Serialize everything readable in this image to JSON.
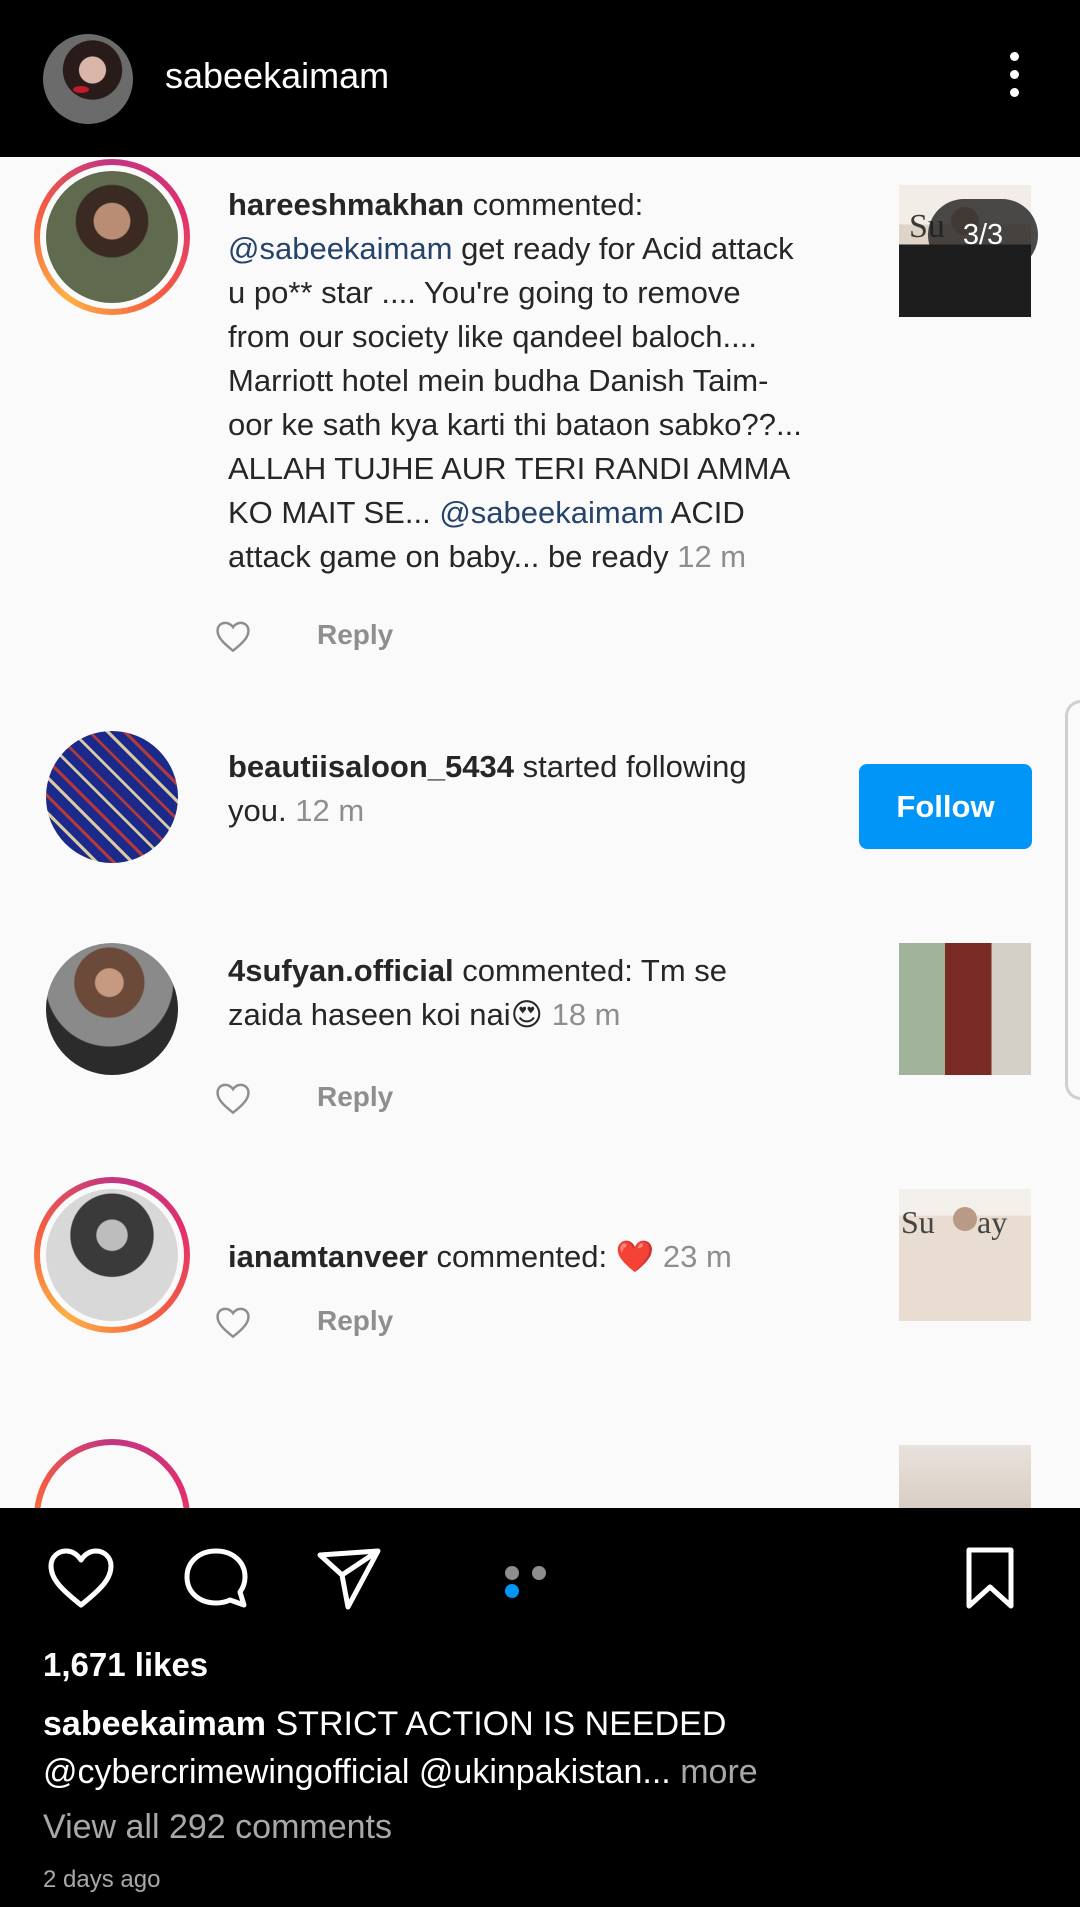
{
  "header": {
    "username": "sabeekaimam"
  },
  "post_image": {
    "counter": "3/3",
    "notifications": [
      {
        "username": "hareeshmakhan",
        "lines": [
          [
            {
              "t": "b",
              "v": "hareeshmakhan"
            },
            {
              "t": "n",
              "v": " commented:"
            }
          ],
          [
            {
              "t": "m",
              "v": "@sabeekaimam"
            },
            {
              "t": "n",
              "v": " get ready for Acid attack"
            }
          ],
          [
            {
              "t": "n",
              "v": "u po** star .... You're going to remove"
            }
          ],
          [
            {
              "t": "n",
              "v": "from our society like qandeel baloch...."
            }
          ],
          [
            {
              "t": "n",
              "v": "Marriott hotel mein budha Danish Taim-"
            }
          ],
          [
            {
              "t": "n",
              "v": "oor ke sath kya karti thi bataon sabko??..."
            }
          ],
          [
            {
              "t": "n",
              "v": "ALLAH TUJHE AUR TERI RANDI AMMA"
            }
          ],
          [
            {
              "t": "n",
              "v": "KO MAIT SE... "
            },
            {
              "t": "m",
              "v": "@sabeekaimam"
            },
            {
              "t": "n",
              "v": " ACID"
            }
          ],
          [
            {
              "t": "n",
              "v": "attack game on baby... be ready "
            },
            {
              "t": "time",
              "v": "12 m"
            }
          ]
        ],
        "reply_label": "Reply"
      },
      {
        "username": "beautiisaloon_5434",
        "lines": [
          [
            {
              "t": "b",
              "v": "beautiisaloon_5434"
            },
            {
              "t": "n",
              "v": " started following"
            }
          ],
          [
            {
              "t": "n",
              "v": "you. "
            },
            {
              "t": "time",
              "v": "12 m"
            }
          ]
        ],
        "follow_label": "Follow"
      },
      {
        "username": "4sufyan.official",
        "lines": [
          [
            {
              "t": "b",
              "v": "4sufyan.official"
            },
            {
              "t": "n",
              "v": " commented: Tm se"
            }
          ],
          [
            {
              "t": "n",
              "v": "zaida haseen koi nai😍 "
            },
            {
              "t": "time",
              "v": "18 m"
            }
          ]
        ],
        "reply_label": "Reply"
      },
      {
        "username": "ianamtanveer",
        "lines": [
          [
            {
              "t": "b",
              "v": "ianamtanveer"
            },
            {
              "t": "n",
              "v": " commented: ❤️ "
            },
            {
              "t": "time",
              "v": "23 m"
            }
          ]
        ],
        "reply_label": "Reply"
      }
    ]
  },
  "actions": {
    "like_icon": "heart-icon",
    "comment_icon": "comment-icon",
    "share_icon": "send-icon",
    "save_icon": "bookmark-icon",
    "carousel_pages": 3,
    "carousel_active": 3
  },
  "likes": "1,671 likes",
  "caption": {
    "username": "sabeekaimam",
    "line1": " STRICT ACTION IS NEEDED",
    "line2": "@cybercrimewingofficial @ukinpakistan...",
    "more": " more"
  },
  "view_all": "View all 292 comments",
  "posted": "2 days ago",
  "colors": {
    "accent": "#0095f6",
    "mention": "#26436b",
    "muted": "#8e8e8e"
  }
}
